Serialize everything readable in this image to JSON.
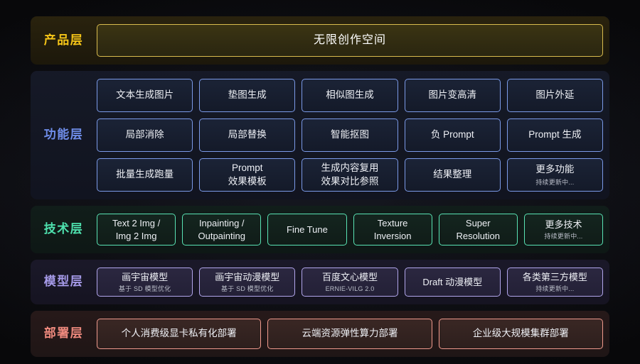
{
  "layers": [
    {
      "id": "product",
      "label": "产品层",
      "accent": "#f5c518",
      "rows": [
        [
          {
            "title": "无限创作空间",
            "sub": ""
          }
        ]
      ]
    },
    {
      "id": "function",
      "label": "功能层",
      "accent": "#7b9ae8",
      "rows": [
        [
          {
            "title": "文本生成图片",
            "sub": ""
          },
          {
            "title": "垫图生成",
            "sub": ""
          },
          {
            "title": "相似图生成",
            "sub": ""
          },
          {
            "title": "图片变高清",
            "sub": ""
          },
          {
            "title": "图片外延",
            "sub": ""
          }
        ],
        [
          {
            "title": "局部消除",
            "sub": ""
          },
          {
            "title": "局部替换",
            "sub": ""
          },
          {
            "title": "智能抠图",
            "sub": ""
          },
          {
            "title": "负 Prompt",
            "sub": ""
          },
          {
            "title": "Prompt 生成",
            "sub": ""
          }
        ],
        [
          {
            "title": "批量生成跑量",
            "sub": ""
          },
          {
            "title": "Prompt\n效果模板",
            "sub": ""
          },
          {
            "title": "生成内容复用\n效果对比参照",
            "sub": ""
          },
          {
            "title": "结果整理",
            "sub": ""
          },
          {
            "title": "更多功能",
            "sub": "持续更新中..."
          }
        ]
      ]
    },
    {
      "id": "tech",
      "label": "技术层",
      "accent": "#59e3b4",
      "rows": [
        [
          {
            "title": "Text 2 Img /\nImg 2 Img",
            "sub": ""
          },
          {
            "title": "Inpainting /\nOutpainting",
            "sub": ""
          },
          {
            "title": "Fine Tune",
            "sub": ""
          },
          {
            "title": "Texture\nInversion",
            "sub": ""
          },
          {
            "title": "Super\nResolution",
            "sub": ""
          },
          {
            "title": "更多技术",
            "sub": "持续更新中..."
          }
        ]
      ]
    },
    {
      "id": "model",
      "label": "模型层",
      "accent": "#b2a6ec",
      "rows": [
        [
          {
            "title": "画宇宙模型",
            "sub": "基于 SD 模型优化"
          },
          {
            "title": "画宇宙动漫模型",
            "sub": "基于 SD 模型优化"
          },
          {
            "title": "百度文心模型",
            "sub": "ERNIE-VILG 2.0"
          },
          {
            "title": "Draft 动漫模型",
            "sub": ""
          },
          {
            "title": "各类第三方模型",
            "sub": "持续更新中..."
          }
        ]
      ]
    },
    {
      "id": "deploy",
      "label": "部署层",
      "accent": "#f09a8d",
      "rows": [
        [
          {
            "title": "个人消费级显卡私有化部署",
            "sub": ""
          },
          {
            "title": "云端资源弹性算力部署",
            "sub": ""
          },
          {
            "title": "企业级大规模集群部署",
            "sub": ""
          }
        ]
      ]
    }
  ]
}
